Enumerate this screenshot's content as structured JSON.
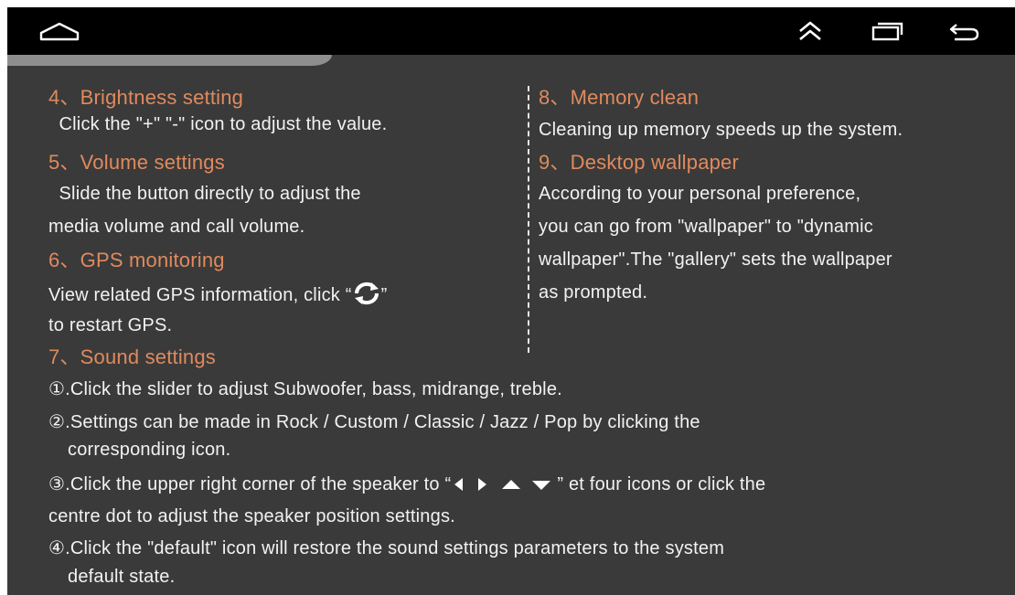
{
  "nav": {
    "home_icon": "home-icon",
    "collapse_icon": "double-chevron-up-icon",
    "recents_icon": "recent-apps-icon",
    "back_icon": "back-arrow-icon"
  },
  "colors": {
    "heading": "#e08a5d",
    "body_text": "#f2f2f2",
    "background": "#3a3a3a",
    "status_bar": "#000000"
  },
  "sections": {
    "brightness": {
      "title": "4、Brightness setting",
      "line1": "  Click the \"+\" \"-\" icon to adjust the value."
    },
    "volume": {
      "title": "5、Volume settings",
      "line1": "  Slide the button directly to adjust the",
      "line2": "media volume and call volume."
    },
    "gps": {
      "title": "6、GPS monitoring",
      "line1_before": "View related GPS information, click “",
      "refresh_icon": "refresh-icon",
      "line1_after": "”",
      "line2": "to restart GPS."
    },
    "sound": {
      "title": "7、Sound settings",
      "item1": "①.Click the slider to adjust Subwoofer, bass, midrange, treble.",
      "item2_line1": "②.Settings can be made in Rock / Custom / Classic / Jazz / Pop by clicking the",
      "item2_line2": "corresponding icon.",
      "item3_before": "③.Click the upper right corner of the speaker to “",
      "arrow_icons": "left-right-up-down-arrow-icons",
      "item3_after": "” et four icons or click the",
      "item3_line2": "centre dot to adjust the speaker position settings.",
      "item4_line1": "④.Click the \"default\" icon will restore the sound settings parameters to the system",
      "item4_line2": "default state."
    },
    "memory": {
      "title": "8、Memory clean",
      "line1": "Cleaning up memory speeds up the system."
    },
    "wallpaper": {
      "title": "9、Desktop wallpaper",
      "line1": "According to your personal preference,",
      "line2": "you can go from \"wallpaper\" to \"dynamic",
      "line3": "wallpaper\".The \"gallery\" sets the wallpaper",
      "line4": "as prompted."
    }
  }
}
